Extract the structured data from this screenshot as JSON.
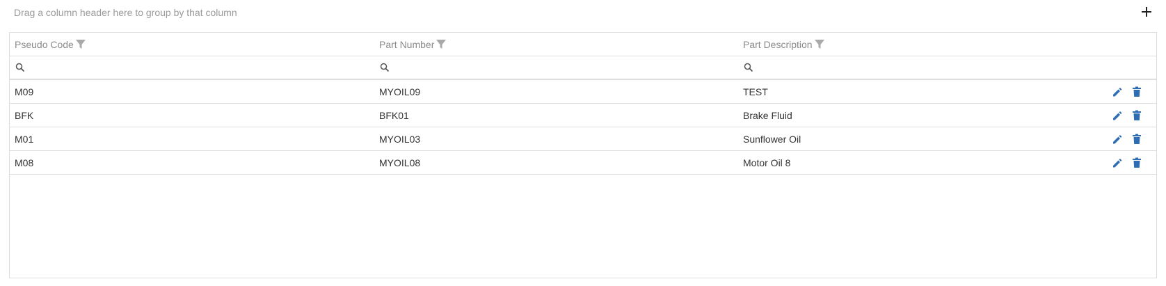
{
  "group_panel": {
    "text": "Drag a column header here to group by that column",
    "add_icon": "plus-icon"
  },
  "columns": [
    {
      "label": "Pseudo Code",
      "filter_icon": "filter-icon"
    },
    {
      "label": "Part Number",
      "filter_icon": "filter-icon"
    },
    {
      "label": "Part Description",
      "filter_icon": "filter-icon"
    }
  ],
  "filters": [
    {
      "value": "",
      "placeholder": "",
      "icon": "search-icon"
    },
    {
      "value": "",
      "placeholder": "",
      "icon": "search-icon"
    },
    {
      "value": "",
      "placeholder": "",
      "icon": "search-icon"
    }
  ],
  "rows": [
    {
      "pseudo_code": "M09",
      "part_number": "MYOIL09",
      "part_description": "TEST"
    },
    {
      "pseudo_code": "BFK",
      "part_number": "BFK01",
      "part_description": "Brake Fluid"
    },
    {
      "pseudo_code": "M01",
      "part_number": "MYOIL03",
      "part_description": "Sunflower Oil"
    },
    {
      "pseudo_code": "M08",
      "part_number": "MYOIL08",
      "part_description": "Motor Oil 8"
    }
  ],
  "row_actions": {
    "edit_icon": "pencil-icon",
    "delete_icon": "trash-icon"
  },
  "colors": {
    "action_blue": "#2e6db4",
    "header_text": "#8a8a8a",
    "filter_icon": "#a9a9a9",
    "border": "#dddddd"
  }
}
